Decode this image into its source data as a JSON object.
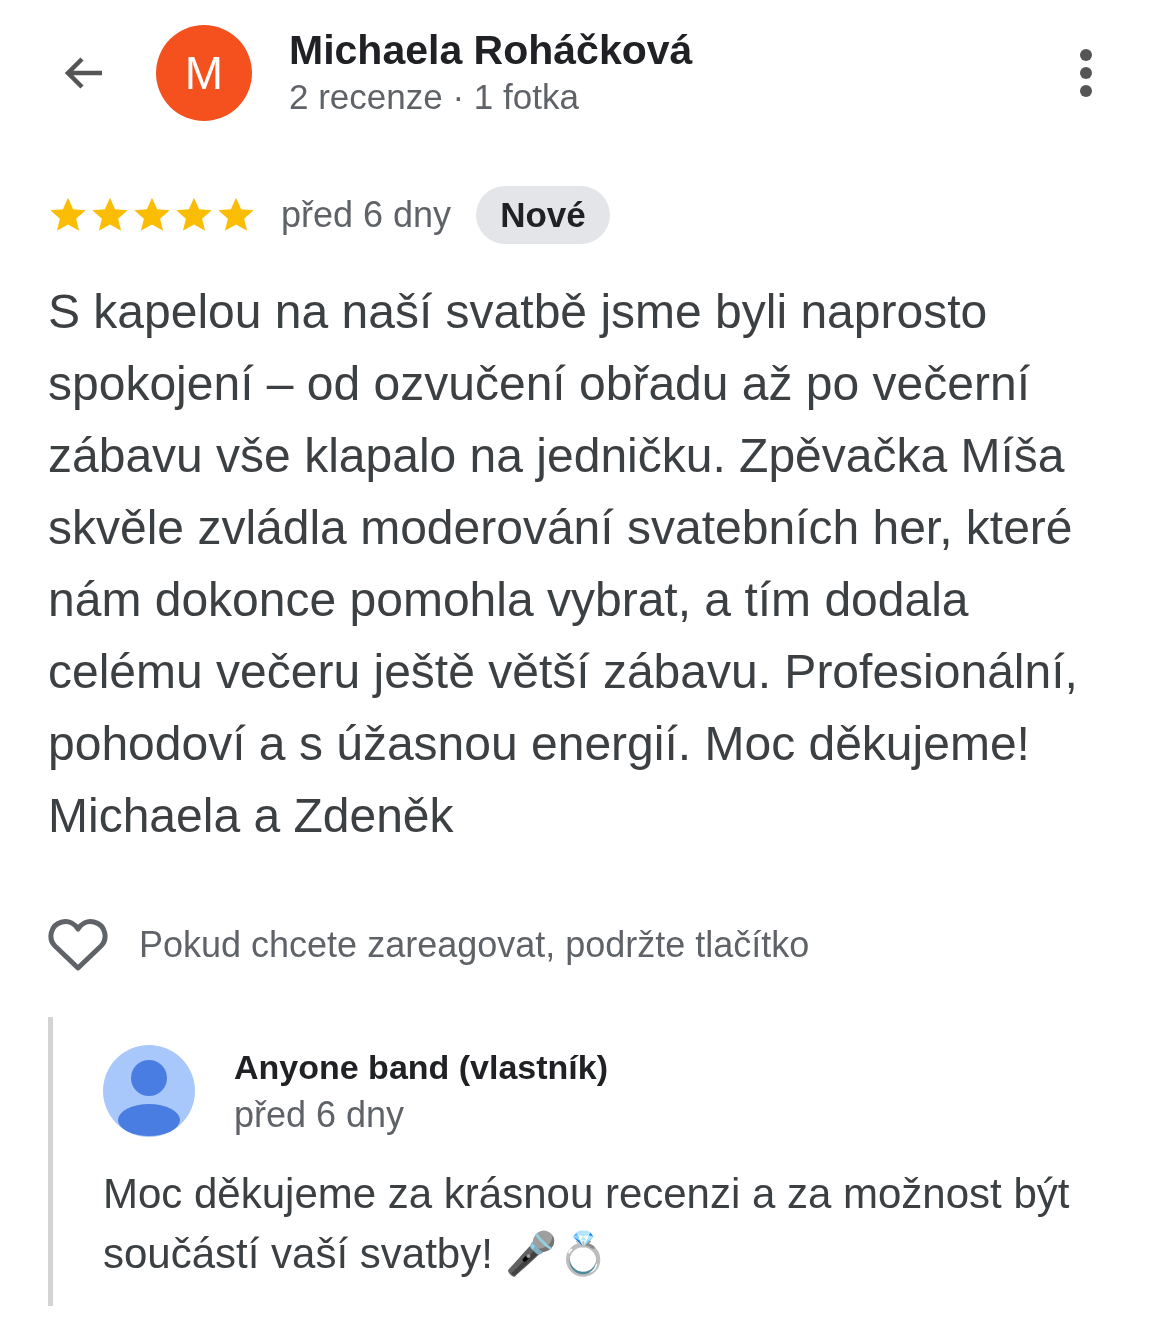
{
  "reviewer": {
    "avatar_letter": "M",
    "name": "Michaela Roháčková",
    "stats": "2 recenze · 1 fotka"
  },
  "review": {
    "stars": 5,
    "time": "před 6 dny",
    "badge": "Nové",
    "text": "S kapelou na naší svatbě jsme byli naprosto spokojení – od ozvučení obřadu až po večerní zábavu vše klapalo na jedničku. Zpěvačka Míša skvěle zvládla moderování svatebních her, které nám dokonce pomohla vybrat, a tím dodala celému večeru ještě větší zábavu. Profesionální, pohodoví a s úžasnou energií. Moc děkujeme! Michaela a Zdeněk"
  },
  "reaction": {
    "hint": "Pokud chcete zareagovat, podržte tlačítko"
  },
  "owner_reply": {
    "name": "Anyone band (vlastník)",
    "time": "před 6 dny",
    "text": "Moc děkujeme za krásnou recenzi a za možnost být součástí vaší svatby! 🎤💍"
  }
}
